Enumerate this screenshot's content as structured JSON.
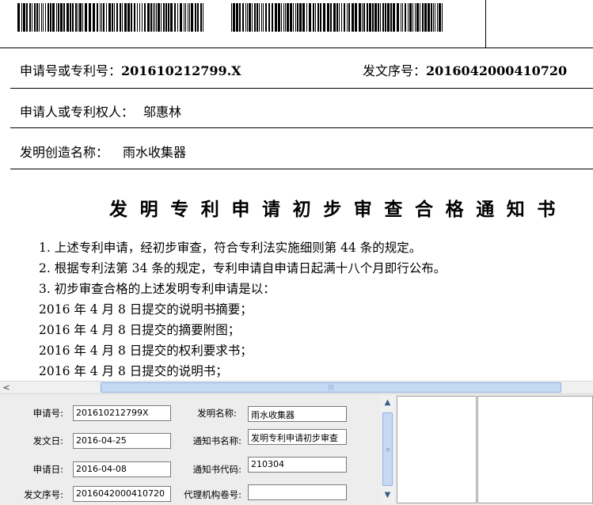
{
  "document": {
    "app_number_label": "申请号或专利号：",
    "app_number_value": "201610212799.X",
    "dispatch_no_label": "发文序号：",
    "dispatch_no_value": "2016042000410720",
    "applicant_label": "申请人或专利权人：",
    "applicant_value": "邬惠林",
    "invention_name_label": "发明创造名称：",
    "invention_name_value": "雨水收集器",
    "notice_title": "发明专利申请初步审查合格通知书",
    "lines": [
      "1. 上述专利申请，经初步审查，符合专利法实施细则第 44 条的规定。",
      "2. 根据专利法第 34 条的规定，专利申请自申请日起满十八个月即行公布。",
      "3. 初步审查合格的上述发明专利申请是以：",
      "2016 年 4 月 8 日提交的说明书摘要；",
      "2016 年 4 月 8 日提交的摘要附图；",
      "2016 年 4 月 8 日提交的权利要求书；",
      "2016 年 4 月 8 日提交的说明书；"
    ]
  },
  "form": {
    "app_no_label": "申请号:",
    "app_no_value": "201610212799X",
    "invention_label": "发明名称:",
    "invention_value": "雨水收集器",
    "dispatch_date_label": "发文日:",
    "dispatch_date_value": "2016-04-25",
    "notice_name_label": "通知书名称:",
    "notice_name_value": "发明专利申请初步审查",
    "filing_date_label": "申请日:",
    "filing_date_value": "2016-04-08",
    "notice_code_label": "通知书代码:",
    "notice_code_value": "210304",
    "serial_label": "发文序号:",
    "serial_value": "2016042000410720",
    "agency_label": "代理机构卷号:",
    "agency_value": ""
  },
  "icons": {
    "scroll_left": "scroll-left-arrow-icon",
    "scroll_up": "scroll-up-arrow-icon",
    "scroll_down": "scroll-down-arrow-icon"
  }
}
